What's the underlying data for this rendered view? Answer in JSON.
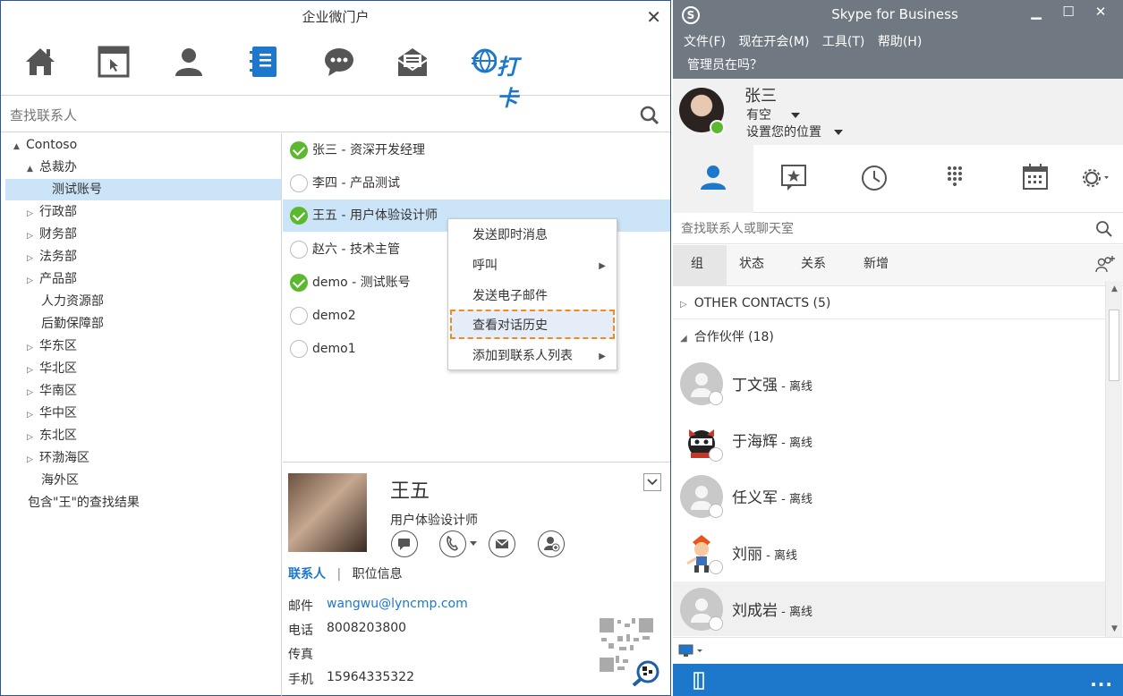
{
  "left": {
    "title": "企业微门户",
    "search_placeholder": "查找联系人",
    "toolbar": [
      "home-icon",
      "browser-icon",
      "person-icon",
      "address-book-icon",
      "chat-icon",
      "mail-icon",
      "daka-icon"
    ],
    "daka_label": "打卡",
    "tree": [
      {
        "label": "Contoso",
        "arrow": "▲"
      },
      {
        "label": "总裁办",
        "arrow": "▲"
      },
      {
        "label": "测试账号",
        "arrow": ""
      },
      {
        "label": "行政部",
        "arrow": "▷"
      },
      {
        "label": "财务部",
        "arrow": "▷"
      },
      {
        "label": "法务部",
        "arrow": "▷"
      },
      {
        "label": "产品部",
        "arrow": "▷"
      },
      {
        "label": "人力资源部",
        "arrow": ""
      },
      {
        "label": "后勤保障部",
        "arrow": ""
      },
      {
        "label": "华东区",
        "arrow": "▷"
      },
      {
        "label": "华北区",
        "arrow": "▷"
      },
      {
        "label": "华南区",
        "arrow": "▷"
      },
      {
        "label": "华中区",
        "arrow": "▷"
      },
      {
        "label": "东北区",
        "arrow": "▷"
      },
      {
        "label": "环渤海区",
        "arrow": "▷"
      },
      {
        "label": "海外区",
        "arrow": ""
      },
      {
        "label": "包含\"王\"的查找结果",
        "arrow": ""
      }
    ],
    "contacts": [
      {
        "name": "张三 - 资深开发经理",
        "online": true
      },
      {
        "name": "李四 - 产品测试",
        "online": false
      },
      {
        "name": "王五 - 用户体验设计师",
        "online": true
      },
      {
        "name": "赵六 - 技术主管",
        "online": false
      },
      {
        "name": "demo - 测试账号",
        "online": true
      },
      {
        "name": "demo2",
        "online": false
      },
      {
        "name": "demo1",
        "online": false
      }
    ],
    "context_menu": [
      {
        "label": "发送即时消息",
        "submenu": false
      },
      {
        "label": "呼叫",
        "submenu": true
      },
      {
        "label": "发送电子邮件",
        "submenu": false
      },
      {
        "label": "查看对话历史",
        "submenu": false
      },
      {
        "label": "添加到联系人列表",
        "submenu": true
      }
    ],
    "card": {
      "name": "王五",
      "title": "用户体验设计师",
      "tab_contact": "联系人",
      "tab_sep": "|",
      "tab_job": "职位信息",
      "fields": [
        {
          "label": "邮件",
          "value": "wangwu@lyncmp.com",
          "link": true
        },
        {
          "label": "电话",
          "value": "8008203800",
          "link": false
        },
        {
          "label": "传真",
          "value": "",
          "link": false
        },
        {
          "label": "手机",
          "value": "15964335322",
          "link": false
        }
      ]
    }
  },
  "skype": {
    "title": "Skype for Business",
    "logo": "S",
    "menu": [
      "文件(F)",
      "现在开会(M)",
      "工具(T)",
      "帮助(H)"
    ],
    "note": "管理员在吗？",
    "user": {
      "name": "张三",
      "status": "有空",
      "location": "设置您的位置"
    },
    "search_placeholder": "查找联系人或聊天室",
    "tabs": [
      "组",
      "状态",
      "关系",
      "新增"
    ],
    "groups": [
      {
        "label": "OTHER CONTACTS (5)",
        "expanded": false
      },
      {
        "label": "合作伙伴 (18)",
        "expanded": true
      }
    ],
    "contacts": [
      {
        "name": "丁文强",
        "status": " - 离线"
      },
      {
        "name": "于海辉",
        "status": " - 离线"
      },
      {
        "name": "任义军",
        "status": " - 离线"
      },
      {
        "name": "刘丽",
        "status": " - 离线"
      },
      {
        "name": "刘成岩",
        "status": " - 离线"
      }
    ],
    "footer_more": "...",
    "colors": {
      "header": "#707982",
      "accent": "#1d78cc",
      "online": "#5cb82f",
      "highlight": "#f08c1e"
    }
  }
}
